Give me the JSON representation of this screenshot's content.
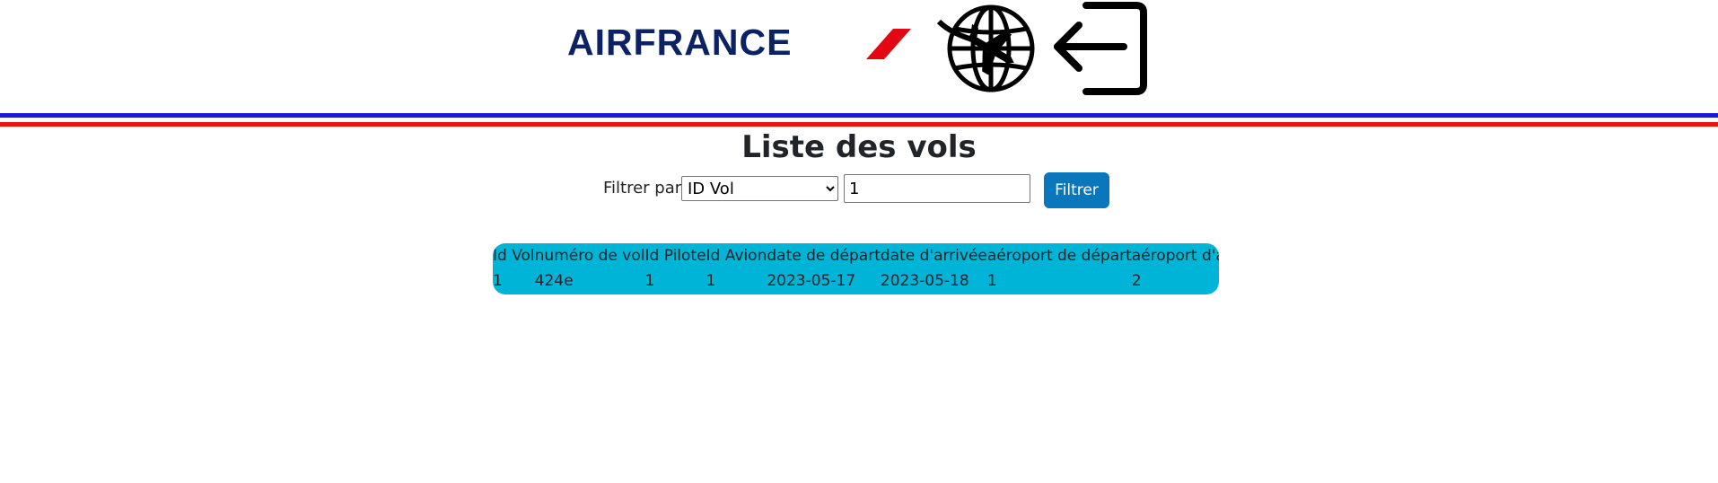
{
  "header": {
    "logo_text": "AIRFRANCE",
    "flight_icon": "globe-airplane-icon",
    "logout_icon": "logout-icon",
    "colors": {
      "blue": "#1a1ad6",
      "red": "#ee1111",
      "logo_navy": "#0b2265",
      "logo_red": "#e30613"
    }
  },
  "page": {
    "title": "Liste des vols"
  },
  "filter": {
    "label": "Filtrer par :",
    "select_value": "ID Vol",
    "options": [
      "ID Vol"
    ],
    "input_value": "1",
    "button_label": "Filtrer",
    "button_color": "#0a77bd"
  },
  "table": {
    "background": "#00b4d8",
    "columns": [
      "Id Vol",
      "numéro de vol",
      "Id Pilote",
      "Id Avion",
      "date de départ",
      "date d'arrivée",
      "aéroport de départ",
      "aéroport d'arrivée"
    ],
    "rows": [
      [
        "1",
        "424e",
        "1",
        "1",
        "2023-05-17",
        "2023-05-18",
        "1",
        "2"
      ]
    ]
  }
}
